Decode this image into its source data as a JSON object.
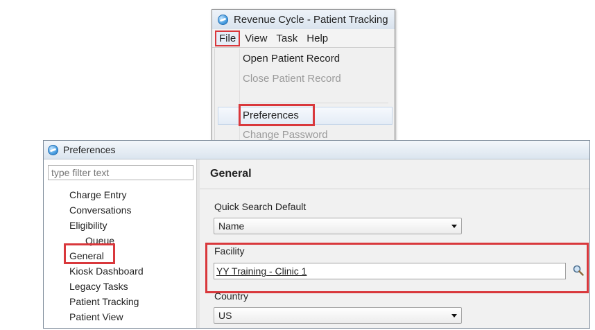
{
  "top_window": {
    "title": "Revenue Cycle - Patient Tracking",
    "menu": [
      "File",
      "View",
      "Task",
      "Help"
    ],
    "file_menu_items": [
      {
        "label": "Open Patient Record",
        "enabled": true
      },
      {
        "label": "Close Patient Record",
        "enabled": false
      },
      {
        "label": "Preferences",
        "enabled": true
      },
      {
        "label": "Change Password",
        "enabled": false
      }
    ]
  },
  "preferences": {
    "title": "Preferences",
    "filter_placeholder": "type filter text",
    "tree_items": [
      "Charge Entry",
      "Conversations",
      "Eligibility",
      "Queue",
      "General",
      "Kiosk Dashboard",
      "Legacy Tasks",
      "Patient Tracking",
      "Patient View"
    ],
    "section_title": "General",
    "quick_search_label": "Quick Search Default",
    "quick_search_value": "Name",
    "facility_label": "Facility",
    "facility_value": "YY Training - Clinic 1",
    "country_label": "Country",
    "country_value": "US"
  },
  "colors": {
    "highlight": "#d9383c",
    "title_bar": "#dbe5ef",
    "pane_background": "#f1f1f1"
  }
}
